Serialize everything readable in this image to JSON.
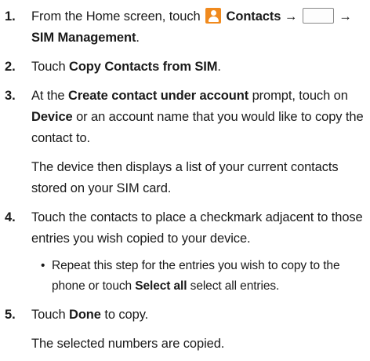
{
  "steps": [
    {
      "num": "1.",
      "parts": [
        "From the Home screen, touch",
        "Contacts",
        "→",
        "→",
        "SIM Management",
        "."
      ]
    },
    {
      "num": "2.",
      "parts": [
        "Touch",
        "Copy Contacts from SIM",
        "."
      ]
    },
    {
      "num": "3.",
      "parts": [
        "At the",
        "Create contact under account",
        "prompt, touch on",
        "Device",
        "or an account name that you would like to copy the contact to."
      ],
      "note": "The device then displays a list of your current contacts stored on your SIM card."
    },
    {
      "num": "4.",
      "text": "Touch the contacts to place a checkmark adjacent to those entries you wish copied to your device.",
      "bullet": {
        "dot": "•",
        "parts": [
          "Repeat this step for the entries you wish to copy to the phone or touch",
          "Select all",
          "select all entries."
        ]
      }
    },
    {
      "num": "5.",
      "parts": [
        "Touch",
        "Done",
        "to copy."
      ],
      "note": "The selected numbers are copied."
    }
  ],
  "icons": {
    "contacts": "contacts-app-icon",
    "menu": "menu-key-icon",
    "accent": "#f08a1e"
  }
}
